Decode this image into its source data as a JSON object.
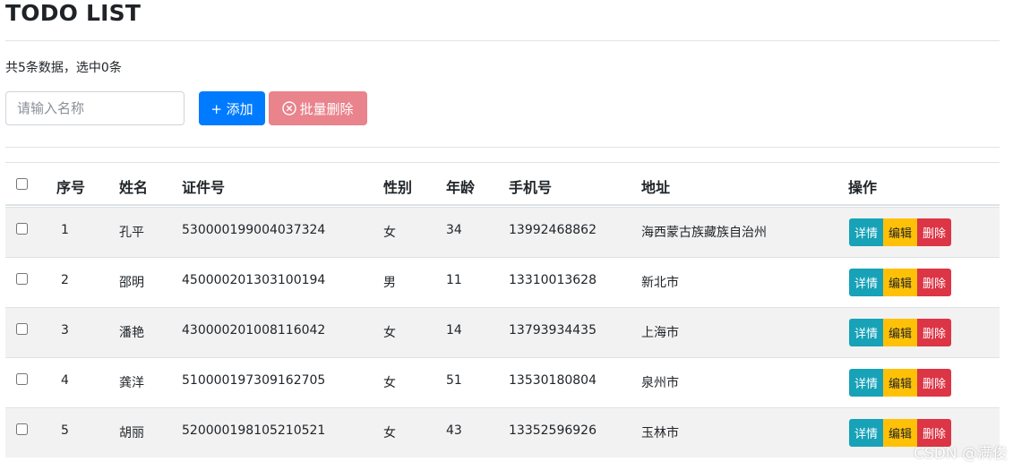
{
  "title": "TODO LIST",
  "summary": "共5条数据，选中0条",
  "search": {
    "placeholder": "请输入名称"
  },
  "toolbar": {
    "add_label": "+ 添加",
    "batch_delete_label": "批量删除"
  },
  "table": {
    "headers": [
      "序号",
      "姓名",
      "证件号",
      "性别",
      "年龄",
      "手机号",
      "地址",
      "操作"
    ],
    "rows": [
      [
        "1",
        "孔平",
        "530000199004037324",
        "女",
        "34",
        "13992468862",
        "海西蒙古族藏族自治州"
      ],
      [
        "2",
        "邵明",
        "450000201303100194",
        "男",
        "11",
        "13310013628",
        "新北市"
      ],
      [
        "3",
        "潘艳",
        "430000201008116042",
        "女",
        "14",
        "13793934435",
        "上海市"
      ],
      [
        "4",
        "龚洋",
        "510000197309162705",
        "女",
        "51",
        "13530180804",
        "泉州市"
      ],
      [
        "5",
        "胡丽",
        "520000198105210521",
        "女",
        "43",
        "13352596926",
        "玉林市"
      ]
    ],
    "actions": {
      "detail": "详情",
      "edit": "编辑",
      "delete": "删除"
    }
  },
  "colors": {
    "primary": "#007bff",
    "danger_light": "#e9838c",
    "info": "#17a2b8",
    "warning": "#ffc107",
    "danger": "#dc3545"
  },
  "watermark": "CSDN @满俊"
}
